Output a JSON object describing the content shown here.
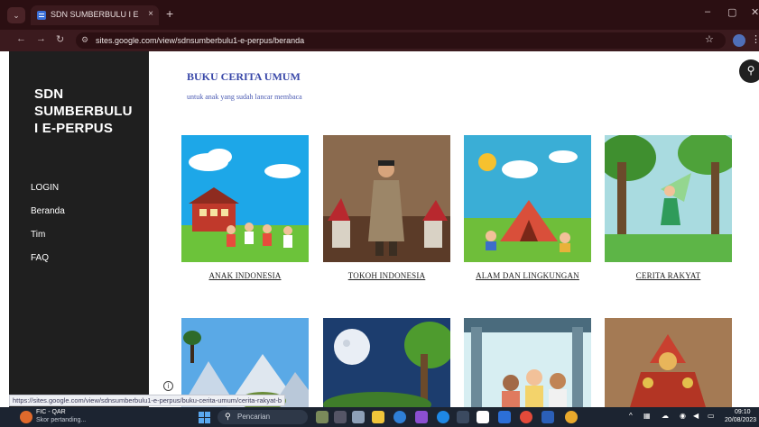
{
  "browser": {
    "tab_title": "SDN SUMBERBULU I E PERPUS",
    "tab_close": "×",
    "new_tab": "+",
    "url": "sites.google.com/view/sdnsumberbulu1-e-perpus/beranda",
    "win_minimize": "–",
    "win_restore": "▢",
    "win_close": "✕"
  },
  "sidebar": {
    "site_title": "SDN SUMBERBULU I E-PERPUS",
    "nav": [
      {
        "label": "LOGIN"
      },
      {
        "label": "Beranda"
      },
      {
        "label": "Tim"
      },
      {
        "label": "FAQ"
      }
    ]
  },
  "main": {
    "heading": "BUKU CERITA UMUM",
    "subheading": "untuk anak yang sudah lancar membaca",
    "cards_row1": [
      {
        "caption": "ANAK INDONESIA",
        "image": "school-children-illustration"
      },
      {
        "caption": "TOKOH INDONESIA",
        "image": "national-hero-illustration"
      },
      {
        "caption": "ALAM DAN LINGKUNGAN",
        "image": "camping-kids-illustration"
      },
      {
        "caption": "CERITA RAKYAT",
        "image": "forest-fairy-illustration"
      }
    ],
    "cards_row2": [
      {
        "image": "mountain-landscape-illustration"
      },
      {
        "image": "night-moon-forest-illustration"
      },
      {
        "image": "family-indoor-illustration"
      },
      {
        "image": "traditional-dancer-illustration"
      }
    ]
  },
  "status_link": "https://sites.google.com/view/sdnsumberbulu1-e-perpus/buku-cerita-umum/cerita-rakyat-b",
  "taskbar": {
    "weather_title": "FIC - QAR",
    "weather_sub": "Skor pertanding...",
    "search_placeholder": "Pencarian",
    "clock_time": "09:10",
    "clock_date": "20/08/2023"
  },
  "colors": {
    "tab_bar": "#2b0f12",
    "toolbar": "#3b1a1e",
    "sidebar": "#1f1f1f",
    "heading": "#3847a8",
    "taskbar": "#1c2431"
  }
}
